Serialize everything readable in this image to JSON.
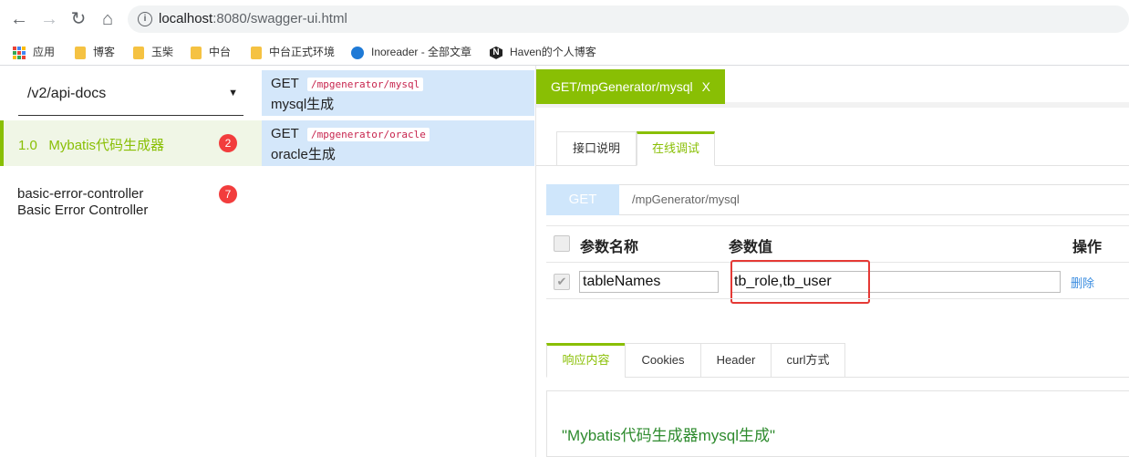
{
  "browser": {
    "url_host": "localhost",
    "url_rest": ":8080/swagger-ui.html",
    "info_icon": "info-icon",
    "bookmarks": [
      {
        "icon": "apps-grid-icon",
        "label": "应用"
      },
      {
        "icon": "folder-icon",
        "label": "博客"
      },
      {
        "icon": "folder-icon",
        "label": "玉柴"
      },
      {
        "icon": "folder-icon",
        "label": "中台"
      },
      {
        "icon": "folder-icon",
        "label": "中台正式环境"
      },
      {
        "icon": "inoreader-icon",
        "label": "Inoreader - 全部文章"
      },
      {
        "icon": "n-logo-icon",
        "label": "Haven的个人博客"
      }
    ]
  },
  "sidebar": {
    "select_value": "/v2/api-docs",
    "groups": [
      {
        "label": "1.0   Mybatis代码生成器",
        "count": "2"
      },
      {
        "label_line1": "basic-error-controller",
        "label_line2": "Basic Error Controller",
        "count": "7"
      }
    ]
  },
  "methods": [
    {
      "verb": "GET",
      "path": "/mpgenerator/mysql",
      "desc": "mysql生成"
    },
    {
      "verb": "GET",
      "path": "/mpgenerator/oracle",
      "desc": "oracle生成"
    }
  ],
  "content": {
    "doc_tab": "GET/mpGenerator/mysql",
    "doc_tab_close": "X",
    "subtabs": [
      "接口说明",
      "在线调试"
    ],
    "request": {
      "method": "GET",
      "url": "/mpGenerator/mysql"
    },
    "params": {
      "headers": [
        "参数名称",
        "参数值",
        "操作"
      ],
      "rows": [
        {
          "name": "tableNames",
          "value": "tb_role,tb_user",
          "action": "删除"
        }
      ]
    },
    "response_tabs": [
      "响应内容",
      "Cookies",
      "Header",
      "curl方式"
    ],
    "response_text": "\"Mybatis代码生成器mysql生成\""
  },
  "colors": {
    "accent": "#89bf04",
    "badge": "#f23d3d",
    "method_bg": "#d4e7fa",
    "highlight": "#e53935"
  }
}
